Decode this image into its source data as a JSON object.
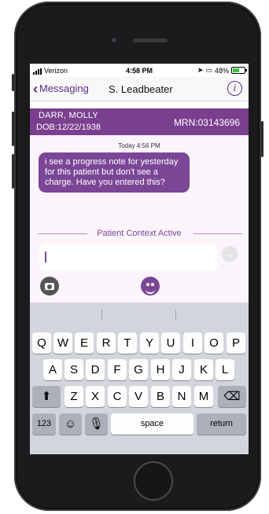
{
  "status_bar": {
    "carrier": "Verizon",
    "time": "4:58 PM",
    "battery": "48%"
  },
  "nav": {
    "back_label": "Messaging",
    "title": "S. Leadbeater",
    "info_label": "i"
  },
  "patient": {
    "name": "DARR, MOLLY",
    "dob": "DOB:12/22/1938",
    "mrn": "MRN:03143696"
  },
  "conversation": {
    "timestamp": "Today 4:56 PM",
    "messages": [
      {
        "text": "i see a progress note for yesterday for this patient but don't see a charge.  Have you entered this?"
      }
    ]
  },
  "context_label": "Patient Context Active",
  "compose": {
    "value": "",
    "send_icon": "arrow-right-icon"
  },
  "toolbar": {
    "camera_icon": "camera-icon",
    "face_icon": "user-face-icon"
  },
  "keyboard": {
    "row1": [
      "Q",
      "W",
      "E",
      "R",
      "T",
      "Y",
      "U",
      "I",
      "O",
      "P"
    ],
    "row2": [
      "A",
      "S",
      "D",
      "F",
      "G",
      "H",
      "J",
      "K",
      "L"
    ],
    "row3": [
      "Z",
      "X",
      "C",
      "V",
      "B",
      "N",
      "M"
    ],
    "numbers_label": "123",
    "space_label": "space",
    "return_label": "return"
  },
  "colors": {
    "accent": "#7b4696",
    "patient_banner": "#7a3f8f",
    "chat_bg": "#fbf5fb",
    "keyboard_bg": "#d2d5db"
  }
}
